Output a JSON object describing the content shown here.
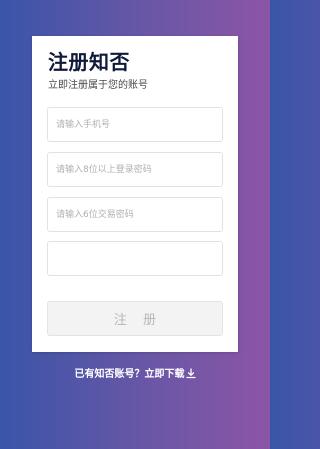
{
  "form": {
    "title": "注册知否",
    "subtitle": "立即注册属于您的账号",
    "phone_placeholder": "请输入手机号",
    "login_password_placeholder": "请输入8位以上登录密码",
    "trade_password_placeholder": "请输入6位交易密码",
    "extra_placeholder": "",
    "submit_label": "注 册"
  },
  "footer": {
    "download_text": "已有知否账号？立即下载",
    "download_icon": "download-icon"
  },
  "colors": {
    "gradient_start": "#3a55a8",
    "gradient_end": "#8c55a6",
    "title": "#0f1a3a",
    "button_bg": "#f3f3f3",
    "button_text": "#b7b7b7"
  }
}
